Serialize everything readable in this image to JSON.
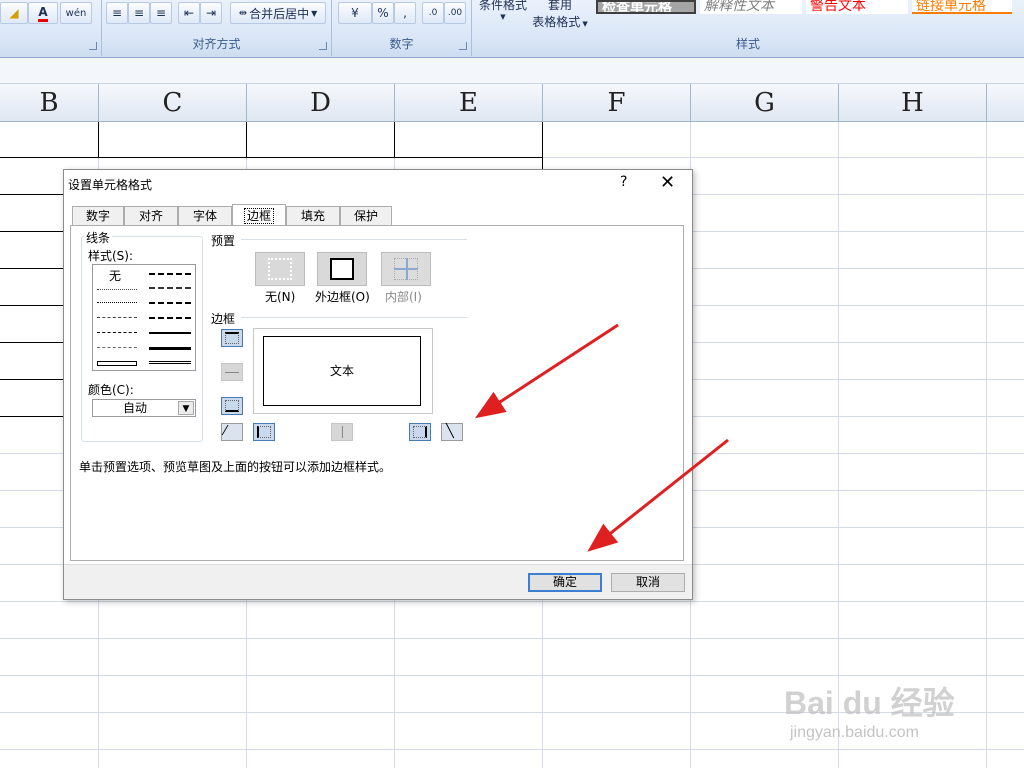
{
  "ribbon": {
    "groups": [
      {
        "label": ""
      },
      {
        "label": "对齐方式"
      },
      {
        "label": "数字"
      },
      {
        "label": "样式"
      }
    ],
    "merge_button": "合并后居中",
    "percent_button": "%",
    "comma_button": ",",
    "cond_format": "条件格式",
    "table_format_top": "套用",
    "table_format": "表格格式",
    "style_cells": [
      {
        "text": "检查单元格",
        "color": "#ffffff"
      },
      {
        "text": "解释性文本",
        "color": "#7f7f7f"
      },
      {
        "text": "警告文本",
        "color": "#ff0000"
      },
      {
        "text": "链接单元格",
        "color": "#fa7d00"
      }
    ]
  },
  "sheet": {
    "columns": [
      "B",
      "C",
      "D",
      "E",
      "F",
      "G",
      "H"
    ]
  },
  "dialog": {
    "title": "设置单元格格式",
    "help": "?",
    "close": "✕",
    "tabs": [
      "数字",
      "对齐",
      "字体",
      "边框",
      "填充",
      "保护"
    ],
    "active_tab": "边框",
    "line_section": "线条",
    "style_label": "样式(S):",
    "style_none": "无",
    "color_label": "颜色(C):",
    "color_value": "自动",
    "preset_section": "预置",
    "presets": [
      "无(N)",
      "外边框(O)",
      "内部(I)"
    ],
    "border_section": "边框",
    "preview_text": "文本",
    "hint": "单击预置选项、预览草图及上面的按钮可以添加边框样式。",
    "ok": "确定",
    "cancel": "取消"
  },
  "watermark": {
    "logo": "Bai du 经验",
    "url": "jingyan.baidu.com"
  }
}
